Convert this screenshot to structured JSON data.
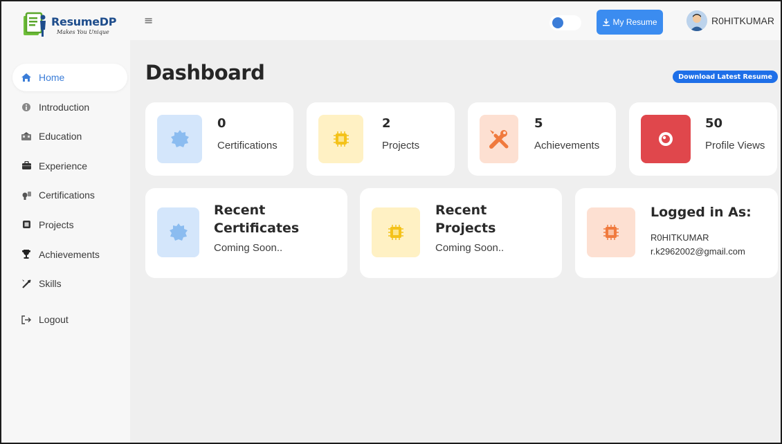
{
  "app": {
    "logo_title": "ResumeDP",
    "logo_tagline": "Makes You Unique"
  },
  "sidebar": {
    "items": [
      {
        "label": "Home",
        "icon": "home-icon",
        "active": true
      },
      {
        "label": "Introduction",
        "icon": "info-icon"
      },
      {
        "label": "Education",
        "icon": "education-icon"
      },
      {
        "label": "Experience",
        "icon": "briefcase-icon"
      },
      {
        "label": "Certifications",
        "icon": "certificate-icon"
      },
      {
        "label": "Projects",
        "icon": "projects-icon"
      },
      {
        "label": "Achievements",
        "icon": "trophy-icon"
      },
      {
        "label": "Skills",
        "icon": "tools-icon"
      }
    ],
    "logout_label": "Logout"
  },
  "topbar": {
    "menu_icon": "hamburger-icon",
    "my_resume_label": "My Resume",
    "username": "R0HITKUMAR"
  },
  "dashboard": {
    "title": "Dashboard",
    "download_label": "Download Latest Resume",
    "stats": [
      {
        "value": "0",
        "label": "Certifications",
        "color": "#d4e6fb",
        "icon": "badge-icon"
      },
      {
        "value": "2",
        "label": "Projects",
        "color": "#fff1c4",
        "icon": "chip-icon"
      },
      {
        "value": "5",
        "label": "Achievements",
        "color": "#fde0d2",
        "icon": "tools-icon"
      },
      {
        "value": "50",
        "label": "Profile Views",
        "color": "#e0474c",
        "icon": "eye-icon"
      }
    ],
    "recent_certificates": {
      "title_line1": "Recent",
      "title_line2": "Certificates",
      "status": "Coming Soon.."
    },
    "recent_projects": {
      "title_line1": "Recent",
      "title_line2": "Projects",
      "status": "Coming Soon.."
    },
    "logged_in": {
      "title": "Logged in As:",
      "username": "R0HITKUMAR",
      "email": "r.k2962002@gmail.com"
    }
  },
  "colors": {
    "accent": "#3b7dd8",
    "primary_button": "#3b8cf0",
    "download_button": "#1e6fe8",
    "page_background": "#efefef"
  }
}
